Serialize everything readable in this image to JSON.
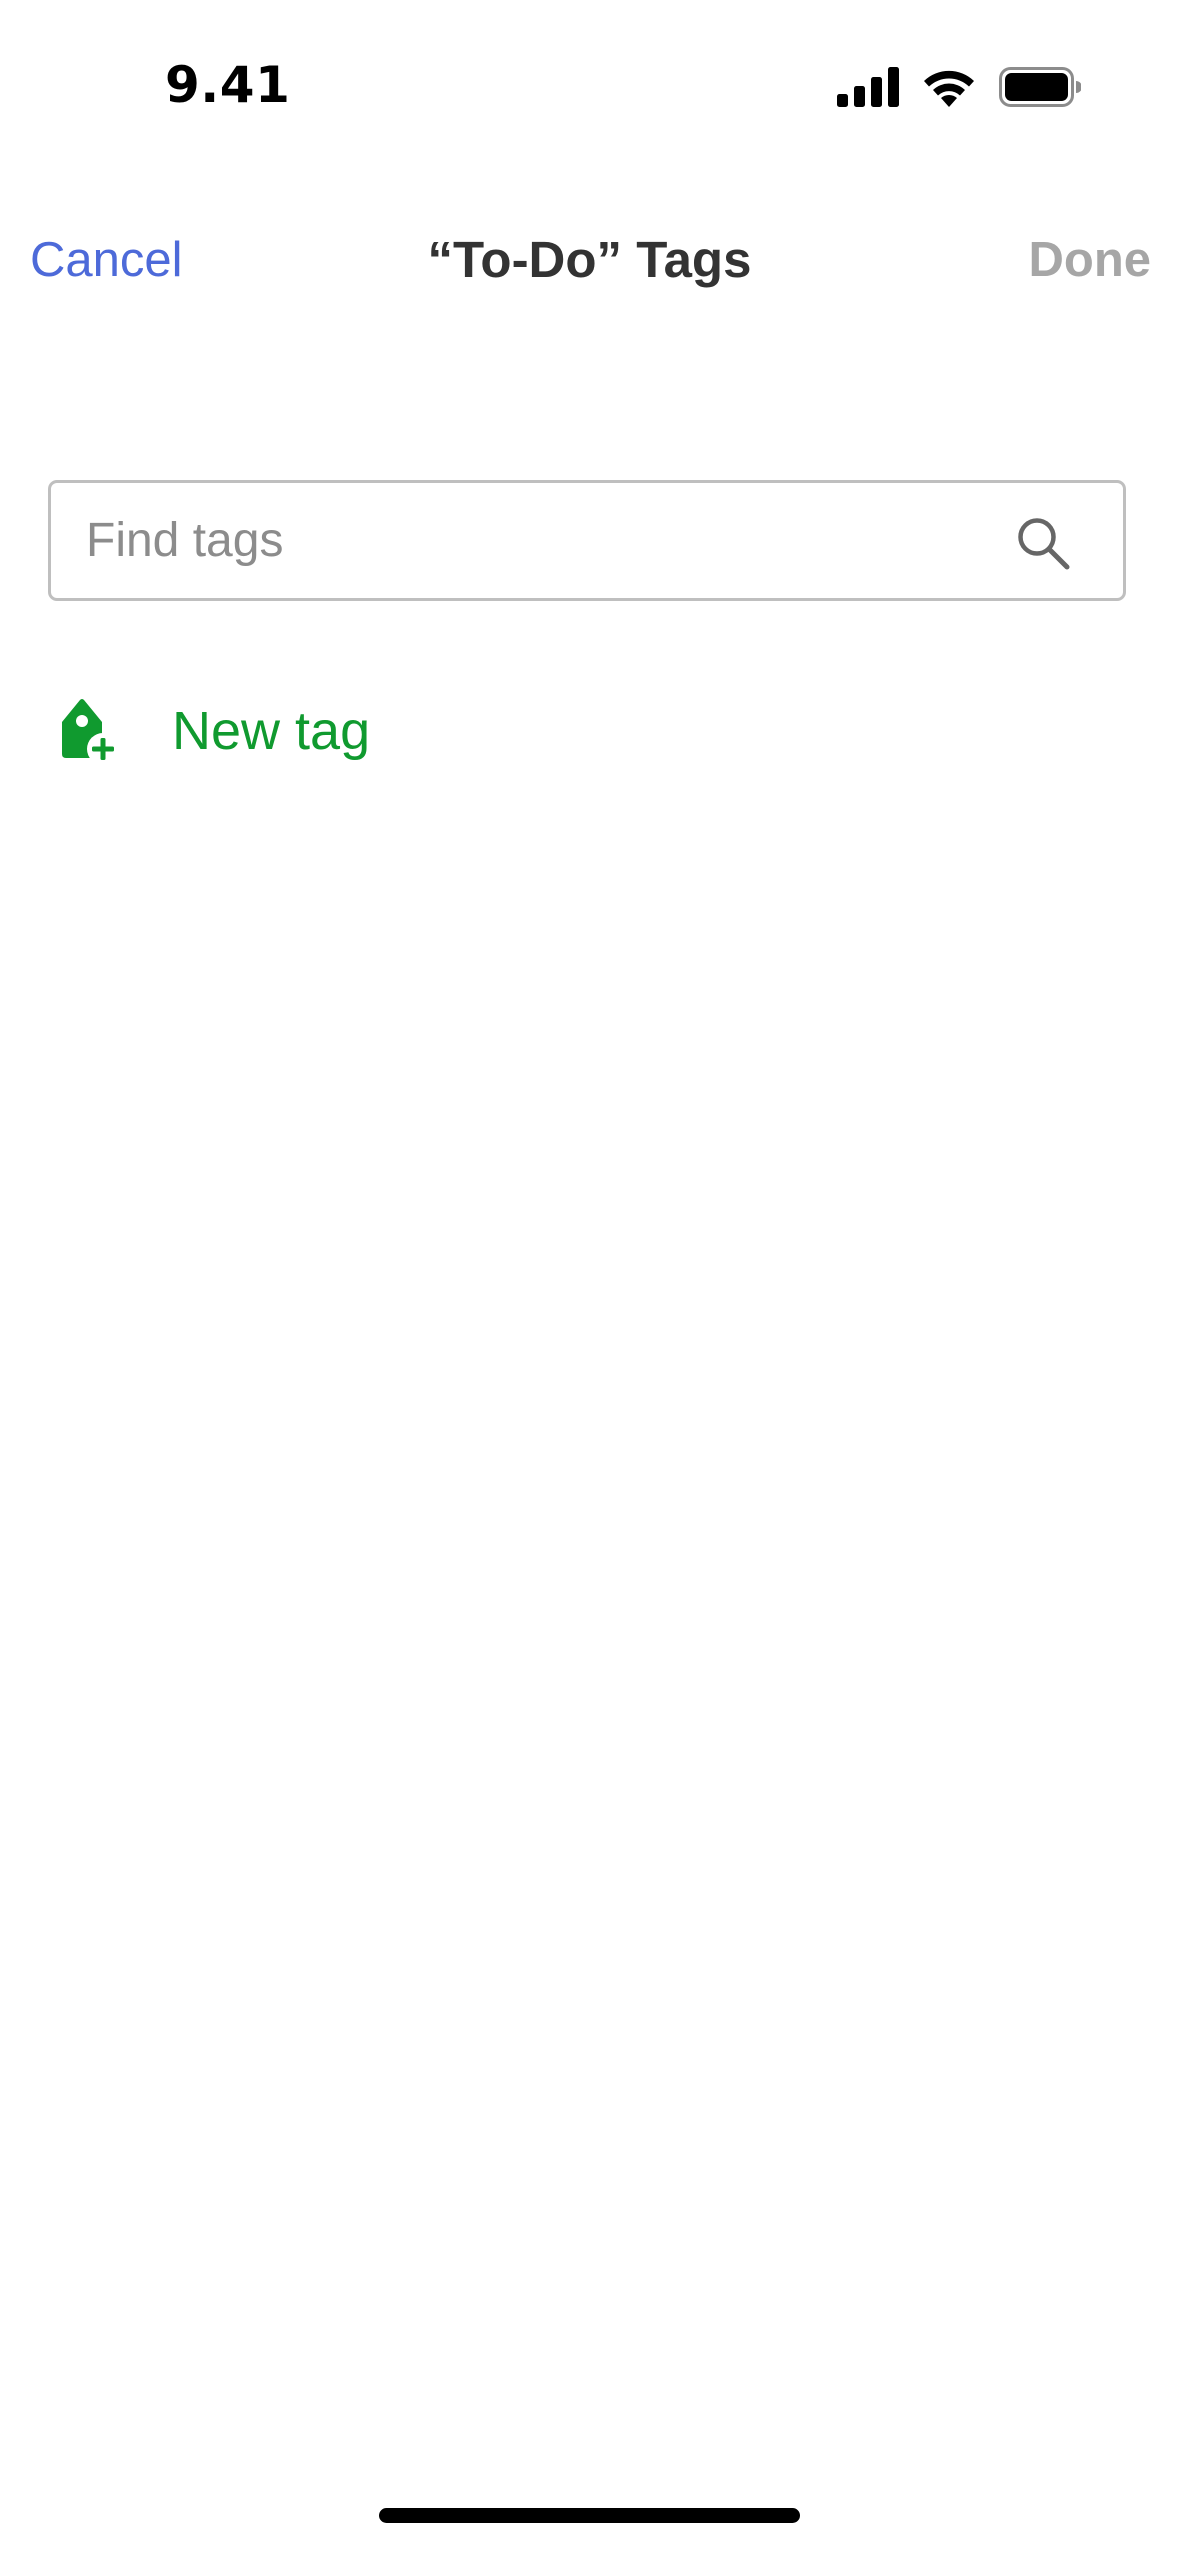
{
  "status_bar": {
    "time": "9.41",
    "icons": [
      "cellular-signal-icon",
      "wifi-icon",
      "battery-icon"
    ]
  },
  "nav": {
    "cancel_label": "Cancel",
    "title": "“To-Do” Tags",
    "done_label": "Done"
  },
  "search": {
    "placeholder": "Find tags",
    "value": "",
    "icon": "search-icon"
  },
  "new_tag": {
    "label": "New tag",
    "icon": "tag-add-icon"
  },
  "colors": {
    "accent_blue": "#4d6ad9",
    "accent_green": "#109a2f",
    "disabled_gray": "#a6a6a6"
  }
}
